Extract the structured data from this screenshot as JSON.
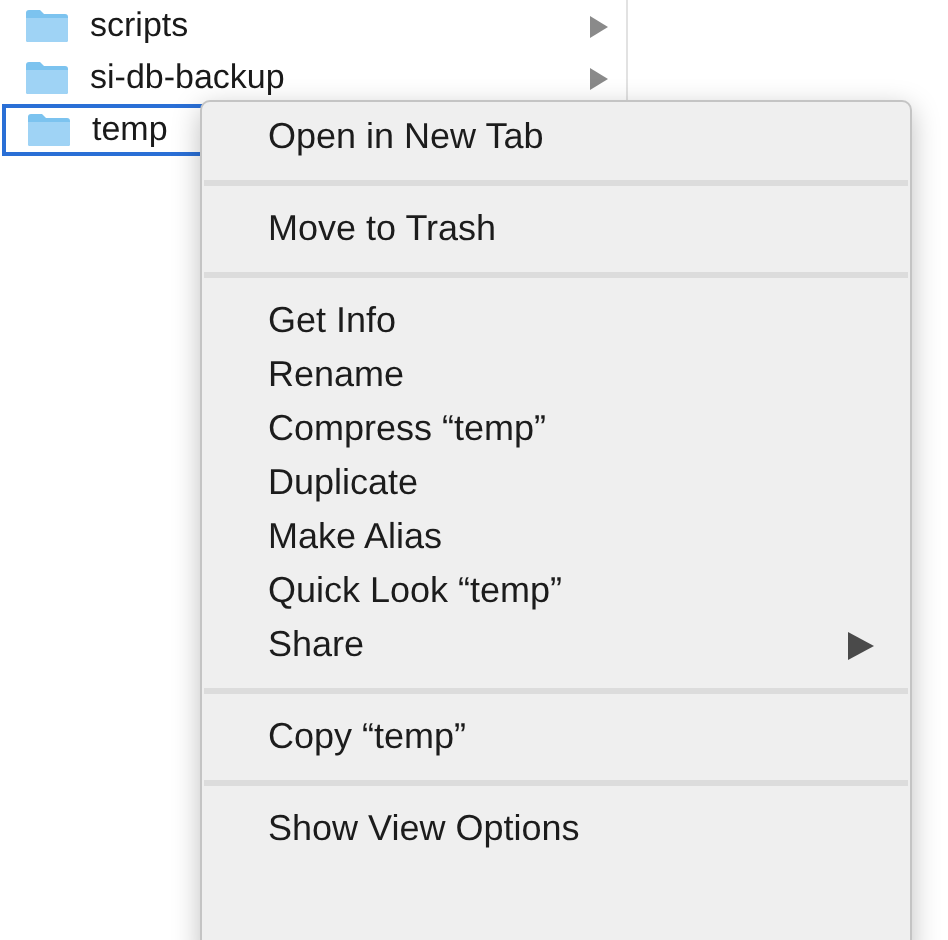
{
  "file_list": {
    "rows": [
      {
        "name": "scripts",
        "selected": false,
        "has_children": true
      },
      {
        "name": "si-db-backup",
        "selected": false,
        "has_children": true
      },
      {
        "name": "temp",
        "selected": true,
        "has_children": false
      }
    ]
  },
  "context_menu": {
    "groups": [
      [
        {
          "label": "Open in New Tab",
          "submenu": false
        }
      ],
      [
        {
          "label": "Move to Trash",
          "submenu": false
        }
      ],
      [
        {
          "label": "Get Info",
          "submenu": false
        },
        {
          "label": "Rename",
          "submenu": false
        },
        {
          "label": "Compress “temp”",
          "submenu": false
        },
        {
          "label": "Duplicate",
          "submenu": false
        },
        {
          "label": "Make Alias",
          "submenu": false
        },
        {
          "label": "Quick Look “temp”",
          "submenu": false
        },
        {
          "label": "Share",
          "submenu": true
        }
      ],
      [
        {
          "label": "Copy “temp”",
          "submenu": false
        }
      ],
      [
        {
          "label": "Show View Options",
          "submenu": false
        }
      ]
    ]
  }
}
